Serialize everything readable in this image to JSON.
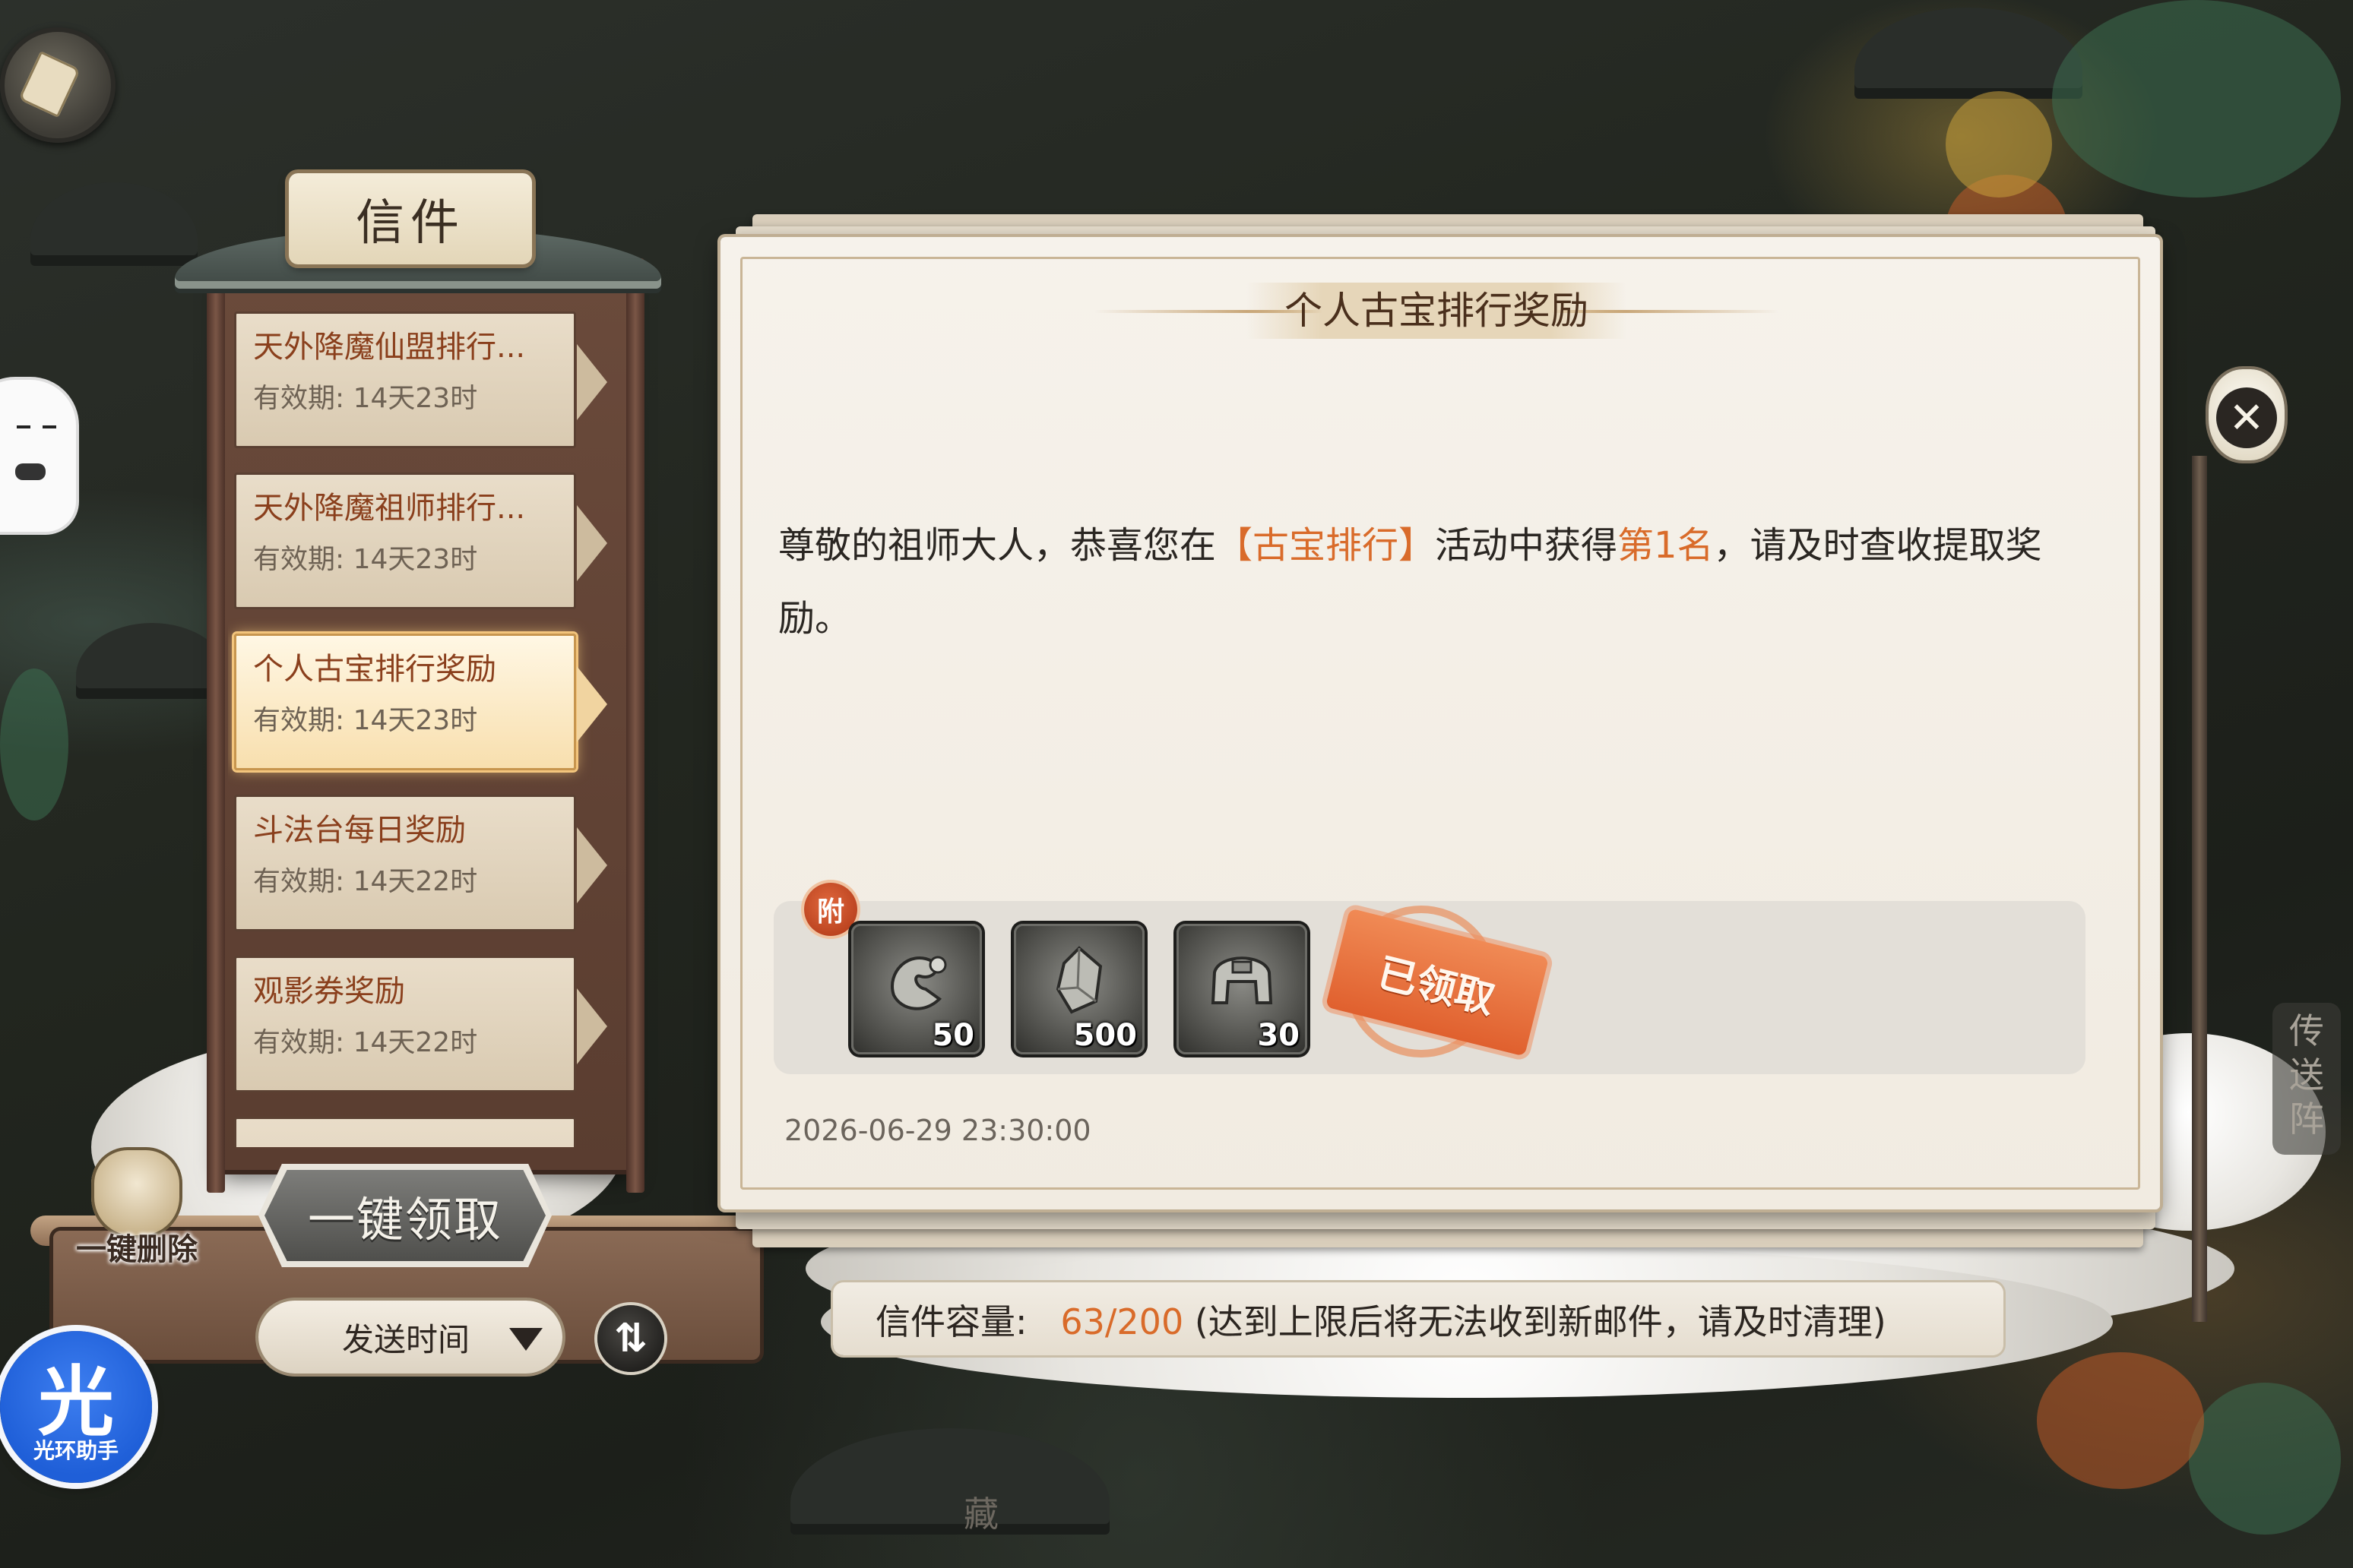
{
  "mail_panel": {
    "title": "信件",
    "items": [
      {
        "title": "天外降魔仙盟排行...",
        "expire": "有效期: 14天23时",
        "selected": false
      },
      {
        "title": "天外降魔祖师排行...",
        "expire": "有效期: 14天23时",
        "selected": false
      },
      {
        "title": "个人古宝排行奖励",
        "expire": "有效期: 14天23时",
        "selected": true
      },
      {
        "title": "斗法台每日奖励",
        "expire": "有效期: 14天22时",
        "selected": false
      },
      {
        "title": "观影券奖励",
        "expire": "有效期: 14天22时",
        "selected": false
      }
    ],
    "delete_all_label": "一键删除",
    "claim_all_label": "一键领取",
    "sort_label": "发送时间",
    "sort_toggle_icon": "⇅"
  },
  "letter": {
    "title": "个人古宝排行奖励",
    "body_part1": "尊敬的祖师大人，恭喜您在",
    "body_highlight1": "【古宝排行】",
    "body_part2": "活动中获得",
    "body_highlight2": "第1名",
    "body_part3": "，请及时查收提取奖励。",
    "attachment_badge": "附",
    "attachments": [
      {
        "icon": "scroll-relic-icon",
        "qty": "50"
      },
      {
        "icon": "ore-crystal-icon",
        "qty": "500"
      },
      {
        "icon": "helmet-icon",
        "qty": "30"
      }
    ],
    "claimed_stamp": "已领取",
    "date": "2026-06-29 23:30:00"
  },
  "capacity": {
    "label": "信件容量:",
    "value": "63/200",
    "note": "(达到上限后将无法收到新邮件，请及时清理)"
  },
  "side": {
    "portal_label": "传送阵",
    "library_label": "藏"
  },
  "helper": {
    "glyph": "光",
    "label": "光环助手"
  },
  "close_icon_glyph": "✕",
  "colors": {
    "highlight": "#d96b2a",
    "mail_title": "#8a3f1c",
    "stamp": "#e0602e",
    "helper_blue": "#1f5fd8"
  }
}
